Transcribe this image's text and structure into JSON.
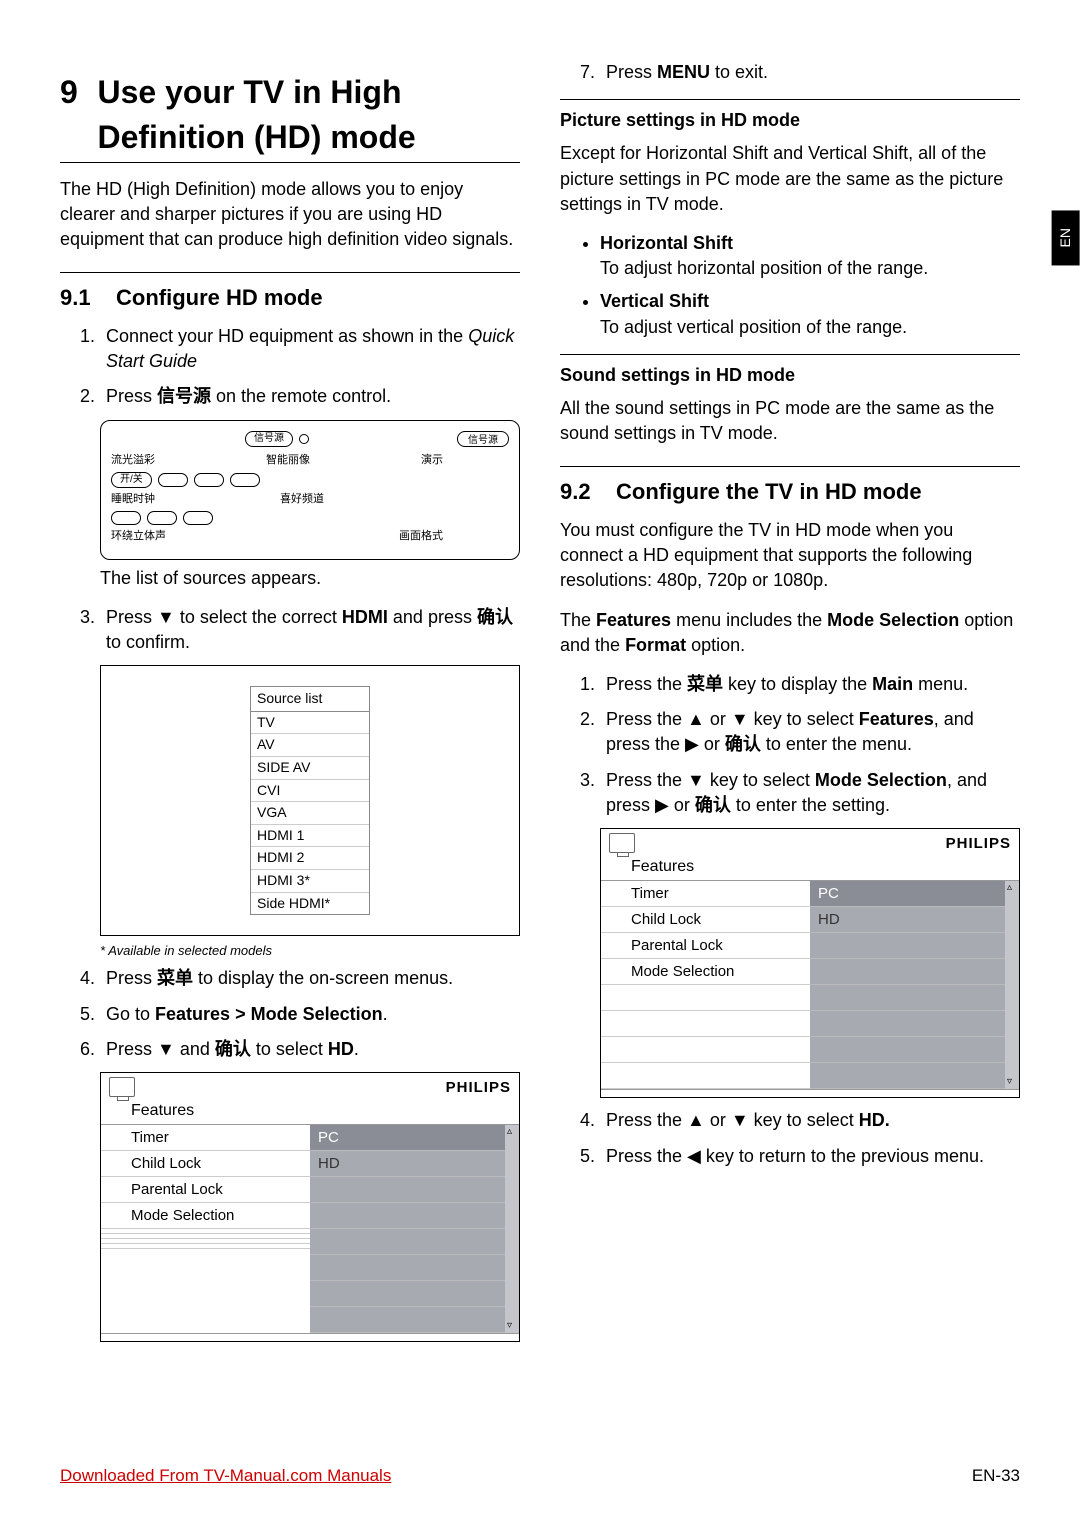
{
  "chapter": {
    "num": "9",
    "title": "Use your TV in High Definition (HD) mode"
  },
  "intro": "The HD (High Definition) mode allows you to enjoy clearer and sharper pictures if you are using HD equipment that can produce high definition video signals.",
  "s91": {
    "num": "9.1",
    "title": "Configure HD mode"
  },
  "step1a": "Connect your HD equipment as shown in the ",
  "step1b": "Quick Start Guide",
  "step2a": "Press ",
  "step2b": "信号源",
  "step2c": " on the remote control.",
  "remote": {
    "topBtn": "信号源",
    "row1": [
      "流光溢彩",
      "智能丽像",
      "演示"
    ],
    "row1btn": "开/关",
    "row2": [
      "睡眠时钟",
      "喜好频道"
    ],
    "row3a": "环绕立体声",
    "row3b": "画面格式",
    "rightBtn": "信号源"
  },
  "afterRemote": "The list of sources appears.",
  "step3a": "Press ▼ to select the correct ",
  "step3b": "HDMI",
  "step3c": " and press ",
  "step3d": "确认",
  "step3e": " to confirm.",
  "sourceList": {
    "header": "Source list",
    "items": [
      "TV",
      "AV",
      "SIDE AV",
      "CVI",
      "VGA",
      "HDMI 1",
      "HDMI 2",
      "HDMI 3*",
      "Side HDMI*"
    ]
  },
  "footnote": "* Available in selected models",
  "step4a": "Press ",
  "step4b": "菜单",
  "step4c": " to display the on-screen menus.",
  "step5a": "Go to ",
  "step5b": "Features > Mode Selection",
  "step5c": ".",
  "step6a": "Press ▼ and ",
  "step6b": "确认",
  "step6c": " to select ",
  "step6d": "HD",
  "step6e": ".",
  "menu": {
    "brand": "PHILIPS",
    "title": "Features",
    "left": [
      "Timer",
      "Child Lock",
      "Parental Lock",
      "Mode Selection",
      "",
      "",
      "",
      ""
    ],
    "right": [
      "PC",
      "HD",
      "",
      "",
      "",
      "",
      "",
      ""
    ]
  },
  "step7a": "Press ",
  "step7b": "MENU",
  "step7c": " to exit.",
  "pictureHdr": "Picture settings in HD mode",
  "picturePara": "Except for Horizontal Shift and Vertical Shift, all of the picture settings in PC mode are the same as the picture settings in TV mode.",
  "hShiftLabel": "Horizontal Shift",
  "hShiftText": "To adjust horizontal position of the range.",
  "vShiftLabel": "Vertical Shift",
  "vShiftText": "To adjust vertical position of the range.",
  "soundHdr": "Sound settings in HD mode",
  "soundPara": "All the sound settings in PC mode are the same as the sound settings in TV mode.",
  "s92": {
    "num": "9.2",
    "title": "Configure the TV in HD mode"
  },
  "s92p1": "You must configure the TV in HD mode when you connect a HD equipment that supports the following resolutions: 480p, 720p or 1080p.",
  "s92p2a": "The ",
  "s92p2b": "Features",
  "s92p2c": " menu includes the ",
  "s92p2d": "Mode Selection",
  "s92p2e": " option and the ",
  "s92p2f": "Format",
  "s92p2g": " option.",
  "r1a": "Press the ",
  "r1b": "菜单",
  "r1c": " key to display the ",
  "r1d": "Main",
  "r1e": " menu.",
  "r2a": "Press the ▲ or ▼ key to select ",
  "r2b": "Features",
  "r2c": ", and press the ▶ or ",
  "r2d": "确认",
  "r2e": " to enter the menu.",
  "r3a": "Press  the ▼ key to select ",
  "r3b": "Mode Selection",
  "r3c": ", and press ▶ or ",
  "r3d": "确认",
  "r3e": " to enter the setting.",
  "r4a": "Press the ▲ or ▼ key to select ",
  "r4b": "HD.",
  "r5": "Press the ◀ key to return to the previous menu.",
  "sideTab": "EN",
  "footerLink": "Downloaded From TV-Manual.com Manuals",
  "pageNum": "EN-33"
}
